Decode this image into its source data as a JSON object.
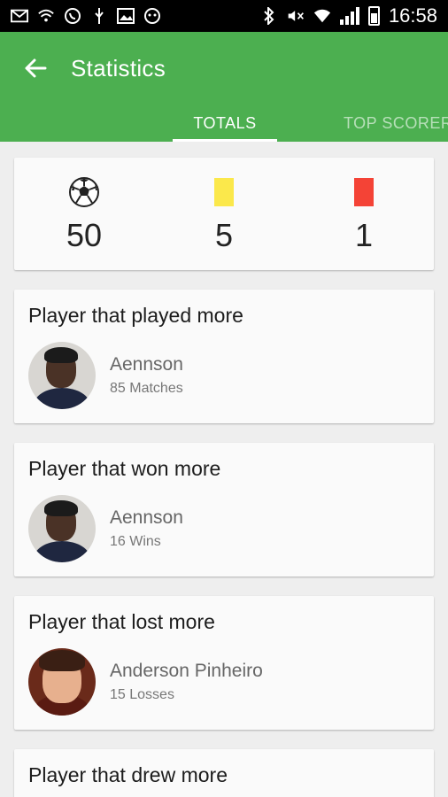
{
  "status_bar": {
    "time": "16:58",
    "icons": [
      "mail-icon",
      "wifi-icon",
      "whatsapp-icon",
      "usb-icon",
      "image-icon",
      "game-icon",
      "bluetooth-icon",
      "mute-icon",
      "wifi-signal-icon",
      "cell-signal-icon",
      "battery-icon"
    ]
  },
  "appbar": {
    "title": "Statistics",
    "back_icon": "arrow-left-icon",
    "color": "#4caf50"
  },
  "tabs": [
    {
      "label": "TOTALS",
      "active": true
    },
    {
      "label": "TOP SCORERS",
      "active": false
    }
  ],
  "totals": {
    "goals": {
      "icon": "soccer-ball-icon",
      "value": "50"
    },
    "yellow_cards": {
      "icon": "yellow-card-icon",
      "value": "5",
      "color": "#fbe84b"
    },
    "red_cards": {
      "icon": "red-card-icon",
      "value": "1",
      "color": "#f44336"
    }
  },
  "stats": [
    {
      "title": "Player that played more",
      "player": "Aennson",
      "detail": "85 Matches"
    },
    {
      "title": "Player that won more",
      "player": "Aennson",
      "detail": "16 Wins"
    },
    {
      "title": "Player that lost more",
      "player": "Anderson Pinheiro",
      "detail": "15 Losses"
    },
    {
      "title": "Player that drew more"
    }
  ]
}
